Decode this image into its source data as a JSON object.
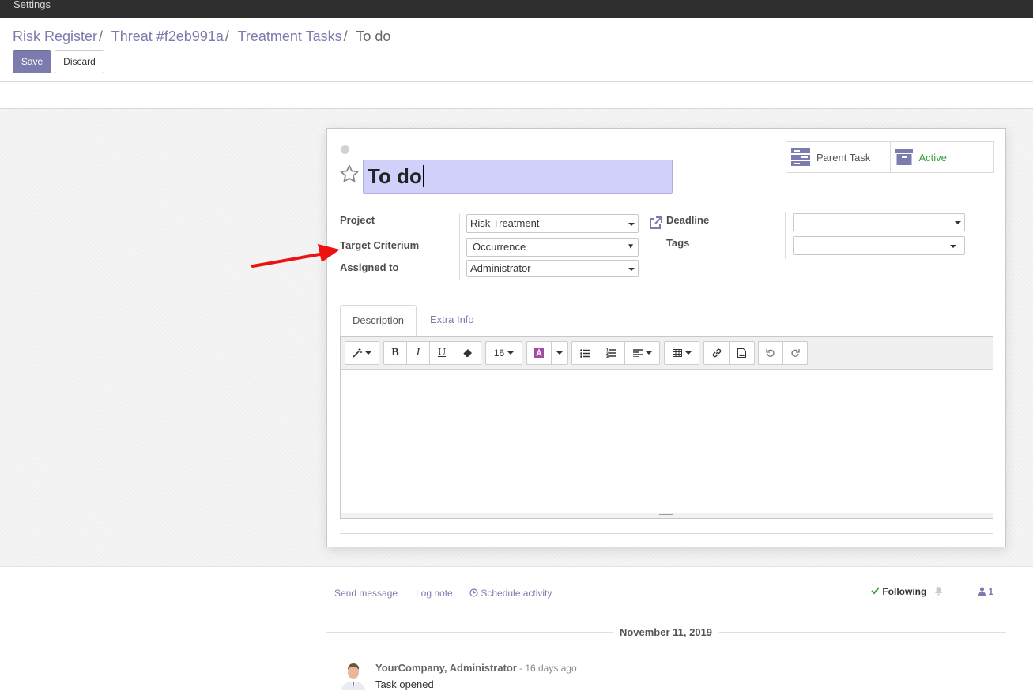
{
  "topbar": {
    "menu_item": "Settings"
  },
  "breadcrumb": {
    "items": [
      "Risk Register",
      "Threat #f2eb991a",
      "Treatment Tasks"
    ],
    "current": "To do",
    "separator": "/"
  },
  "actions": {
    "save": "Save",
    "discard": "Discard"
  },
  "form": {
    "title": "To do",
    "smart_buttons": {
      "parent_task": "Parent Task",
      "active": "Active"
    },
    "labels": {
      "project": "Project",
      "target_criterium": "Target Criterium",
      "assigned_to": "Assigned to",
      "deadline": "Deadline",
      "tags": "Tags"
    },
    "values": {
      "project": "Risk Treatment",
      "target_criterium": "Occurrence",
      "assigned_to": "Administrator",
      "deadline": "",
      "tags": ""
    },
    "tabs": [
      "Description",
      "Extra Info"
    ],
    "editor": {
      "font_size": "16",
      "bold": "B",
      "italic": "I",
      "underline": "U"
    }
  },
  "chatter": {
    "send_message": "Send message",
    "log_note": "Log note",
    "schedule_activity": "Schedule activity",
    "following": "Following",
    "followers_count": "1",
    "date_separator": "November 11, 2019",
    "messages": [
      {
        "author": "YourCompany, Administrator",
        "date": "- 16 days ago",
        "body": "Task opened"
      }
    ]
  },
  "colors": {
    "accent": "#7c7bad",
    "title_highlight": "#d0d0fa",
    "active_green": "#3a9f3a",
    "annotation": "#ee1111"
  },
  "icons": [
    "star-icon",
    "external-link-icon",
    "parent-task-icon",
    "archive-icon",
    "magic-wand-icon",
    "eraser-icon",
    "font-color-icon",
    "unordered-list-icon",
    "ordered-list-icon",
    "align-icon",
    "table-icon",
    "link-icon",
    "picture-icon",
    "undo-icon",
    "redo-icon",
    "check-icon",
    "bell-icon",
    "user-icon",
    "clock-icon"
  ]
}
